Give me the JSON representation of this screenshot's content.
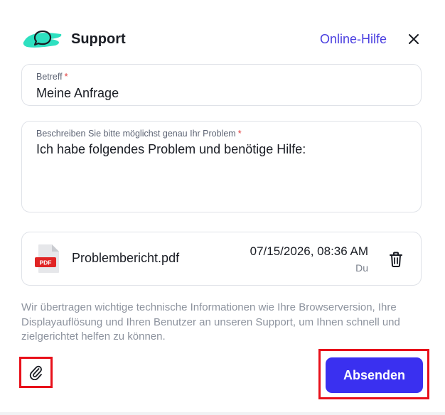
{
  "header": {
    "title": "Support",
    "help_link": "Online-Hilfe",
    "logo_icon": "chat-bubble-icon",
    "close_icon": "close-icon"
  },
  "subject": {
    "label": "Betreff",
    "required_mark": "*",
    "value": "Meine Anfrage"
  },
  "description": {
    "label": "Beschreiben Sie bitte möglichst genau Ihr Problem",
    "required_mark": "*",
    "value": "Ich habe folgendes Problem und benötige Hilfe:"
  },
  "attachment": {
    "file_icon": "pdf-file-icon",
    "file_badge": "PDF",
    "file_name": "Problembericht.pdf",
    "date": "07/15/2026, 08:36 AM",
    "author": "Du",
    "delete_icon": "trash-icon"
  },
  "info_text": "Wir übertragen wichtige technische Informationen wie Ihre Browserversion, Ihre Displayauflösung und Ihren Benutzer an unseren Support, um Ihnen schnell und zielgerichtet helfen zu können.",
  "footer": {
    "attach_icon": "paperclip-icon",
    "send_label": "Absenden"
  },
  "colors": {
    "accent": "#3a30f0",
    "link": "#4a3fe0",
    "logo_brush": "#2ee0c0",
    "required": "#e23a3a",
    "highlight": "#e8101a"
  }
}
